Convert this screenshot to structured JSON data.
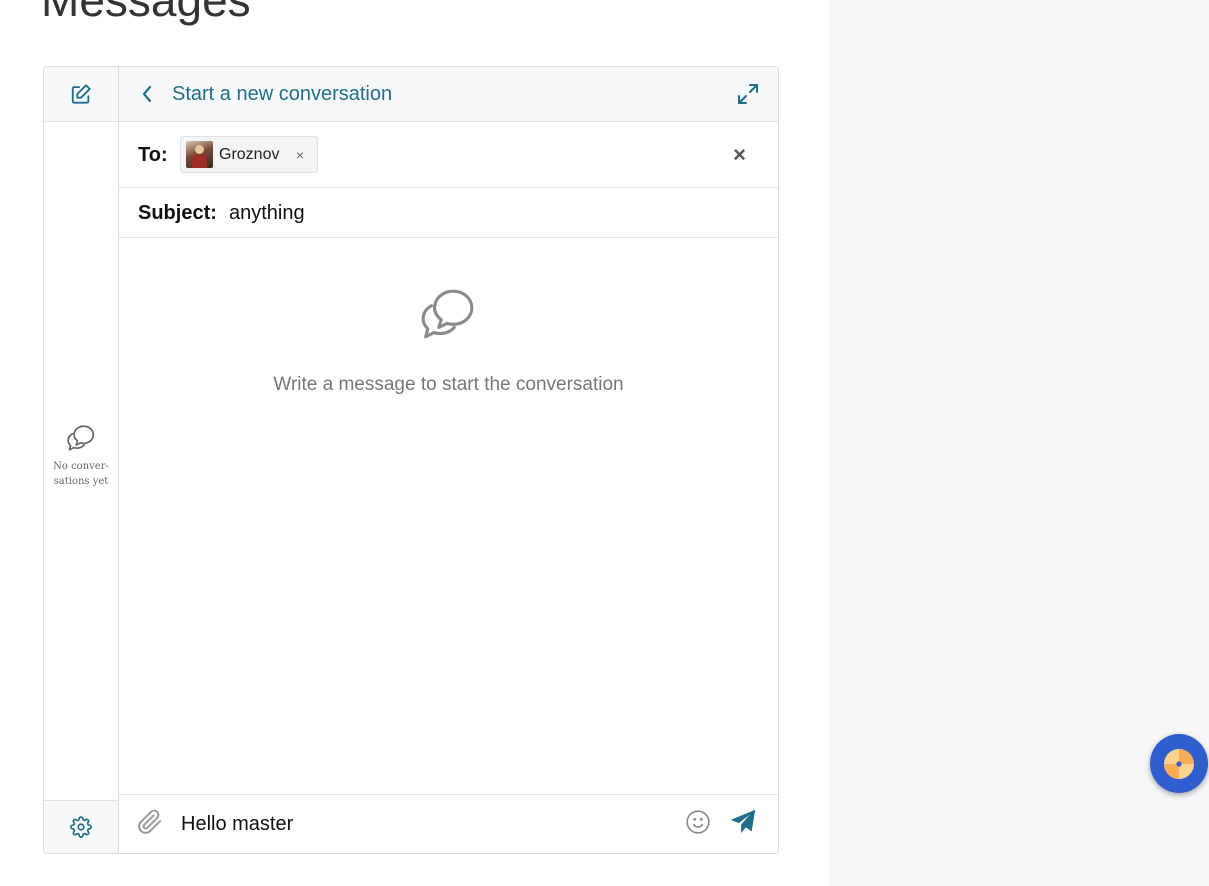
{
  "page": {
    "title": "Messages"
  },
  "rail": {
    "empty_text": "No conver-\nsations yet"
  },
  "header": {
    "title": "Start a new conversation"
  },
  "recipients": {
    "label": "To:",
    "chips": [
      {
        "name": "Groznov",
        "remove": "×"
      }
    ],
    "close": "×"
  },
  "subject": {
    "label": "Subject:",
    "value": "anything"
  },
  "conversation": {
    "empty_text": "Write a message to start the conversation"
  },
  "composer": {
    "value": "Hello master"
  },
  "colors": {
    "accent": "#1f6f8b",
    "fab": "#2f5fcf"
  },
  "icons": [
    "compose-icon",
    "chat-bubbles-icon",
    "gear-icon",
    "chevron-left-icon",
    "expand-icon",
    "paperclip-icon",
    "emoji-icon",
    "send-icon",
    "widget-icon"
  ]
}
